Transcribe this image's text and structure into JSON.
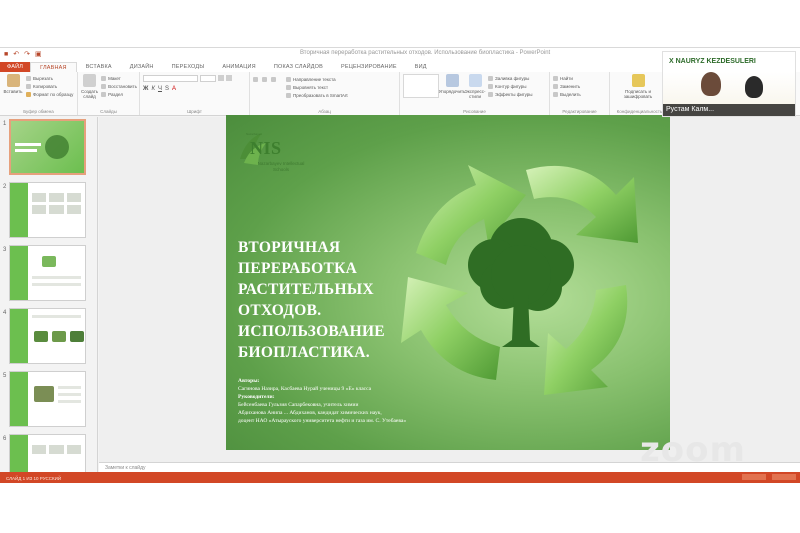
{
  "ppt": {
    "title": "Вторичная переработка растительных отходов. Использование биопластика - PowerPoint",
    "tabs": [
      "ФАЙЛ",
      "ГЛАВНАЯ",
      "ВСТАВКА",
      "ДИЗАЙН",
      "ПЕРЕХОДЫ",
      "АНИМАЦИЯ",
      "ПОКАЗ СЛАЙДОВ",
      "РЕЦЕНЗИРОВАНИЕ",
      "ВИД"
    ],
    "ribbon": {
      "clipboard": {
        "label": "Буфер обмена",
        "paste": "Вставить",
        "cut": "Вырезать",
        "copy": "Копировать",
        "format": "Формат по образцу"
      },
      "slides": {
        "label": "Слайды",
        "new_slide": "Создать слайд",
        "layout": "Макет",
        "reset": "Восстановить",
        "section": "Раздел"
      },
      "font": {
        "label": "Шрифт"
      },
      "paragraph": {
        "label": "Абзац",
        "text_dir": "Направление текста",
        "align": "Выровнять текст",
        "smartart": "Преобразовать в SmartArt"
      },
      "drawing": {
        "label": "Рисование",
        "arrange": "Упорядочить",
        "styles": "Экспресс-стили",
        "fill": "Заливка фигуры",
        "outline": "Контур фигуры",
        "effects": "Эффекты фигуры"
      },
      "editing": {
        "label": "Редактирование",
        "find": "Найти",
        "replace": "Заменить",
        "select": "Выделить"
      },
      "confidential": {
        "label": "Конфиденциальность",
        "sign": "Подписать и зашифровать"
      }
    },
    "notes_placeholder": "Заметки к слайду",
    "status_text": "СЛАЙД 1 ИЗ 10   РУССКИЙ"
  },
  "slide": {
    "logo_text": "NIS",
    "logo_sub": "Nazarbayev Intellectual Schools",
    "title": "ВТОРИЧНАЯ ПЕРЕРАБОТКА РАСТИТЕЛЬНЫХ ОТХОДОВ. ИСПОЛЬЗОВАНИЕ БИОПЛАСТИКА.",
    "authors_label": "Авторы:",
    "authors": "Сагинова Назира, Касбаева Нурай ученицы 9 «Е» класса",
    "supervisors_label": "Руководители:",
    "supervisor1": "Бейсенбаева Гульзия Сапарбековна, учитель химии",
    "supervisor2": "Абдиханова Анипа ... Абдиханов, кандидат химических наук,",
    "supervisor3": "доцент НАО «Атырауского университета нефти и газа им. С. Утебаева»"
  },
  "zoom": {
    "logo": "zoom",
    "participant_name": "Рустам Калм...",
    "tile_banner": "X NAURYZ KEZDESULERI"
  },
  "thumbnails": [
    {
      "num": "1"
    },
    {
      "num": "2"
    },
    {
      "num": "3"
    },
    {
      "num": "4"
    },
    {
      "num": "5"
    },
    {
      "num": "6"
    }
  ]
}
